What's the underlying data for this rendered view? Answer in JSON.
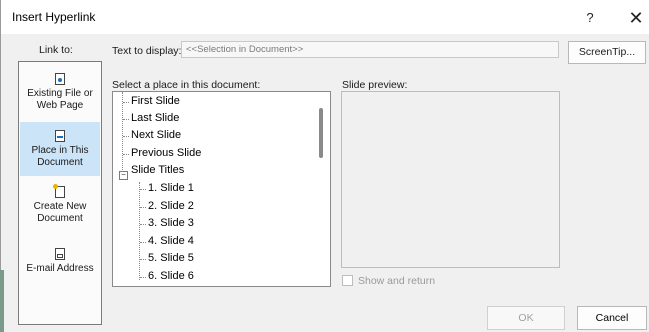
{
  "window": {
    "title": "Insert Hyperlink",
    "help_glyph": "?",
    "close_glyph": "✕"
  },
  "link_to": {
    "label": "Link to:",
    "items": [
      {
        "label": "Existing File or Web Page",
        "icon": "file-web-icon",
        "active": false
      },
      {
        "label": "Place in This Document",
        "icon": "place-in-document-icon",
        "active": true
      },
      {
        "label": "Create New Document",
        "icon": "new-document-icon",
        "active": false
      },
      {
        "label": "E-mail Address",
        "icon": "email-icon",
        "active": false
      }
    ]
  },
  "text_to_display": {
    "label": "Text to display:",
    "value": "<<Selection in Document>>"
  },
  "screentip_button": "ScreenTip...",
  "place_list": {
    "label": "Select a place in this document:",
    "items": [
      {
        "label": "First Slide"
      },
      {
        "label": "Last Slide"
      },
      {
        "label": "Next Slide"
      },
      {
        "label": "Previous Slide"
      },
      {
        "label": "Slide Titles",
        "expander": "−"
      },
      {
        "label": "1. Slide 1"
      },
      {
        "label": "2. Slide 2"
      },
      {
        "label": "3. Slide 3"
      },
      {
        "label": "4. Slide 4"
      },
      {
        "label": "5. Slide 5"
      },
      {
        "label": "6. Slide 6"
      }
    ]
  },
  "preview": {
    "label": "Slide preview:",
    "show_and_return": "Show and return",
    "show_and_return_checked": false
  },
  "buttons": {
    "ok": "OK",
    "cancel": "Cancel"
  },
  "colors": {
    "active_item_bg": "#cce4f7",
    "dialog_bg": "#f0f0f0"
  }
}
